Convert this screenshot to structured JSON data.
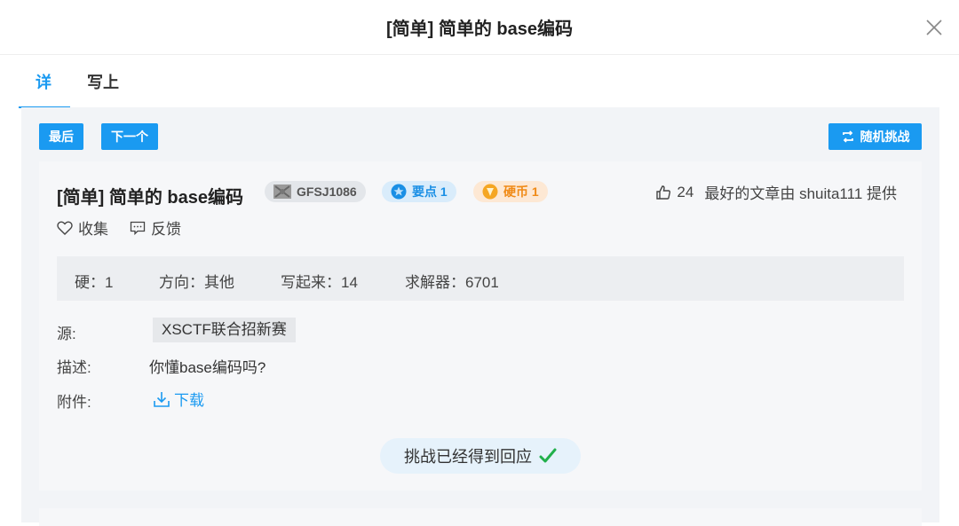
{
  "modal": {
    "title": "[简单] 简单的 base编码"
  },
  "tabs": [
    {
      "label": "详",
      "active": true
    },
    {
      "label": "写上",
      "active": false
    }
  ],
  "toolbar": {
    "last_label": "最后",
    "next_label": "下一个",
    "random_label": "随机挑战"
  },
  "challenge": {
    "title": "[简单] 简单的 base编码",
    "id_badge": "GFSJ1086",
    "points_badge": "要点 1",
    "coin_badge": "硬币 1",
    "likes": "24",
    "writeup_credit": "最好的文章由 shuita111 提供",
    "favorite_label": "收集",
    "feedback_label": "反馈",
    "stats": {
      "difficulty": "硬：1",
      "direction": "方向：其他",
      "writeups": "写起来：14",
      "solvers": "求解器：6701"
    },
    "source_label": "源:",
    "source_value": "XSCTF联合招新赛",
    "description_label": "描述:",
    "description_value": "你懂base编码吗?",
    "attachment_label": "附件:",
    "download_label": "下载",
    "status_text": "挑战已经得到回应"
  },
  "colors": {
    "accent": "#1a9af1",
    "success": "#22b04b",
    "points": "#1a8fe5",
    "coin": "#f08a16"
  },
  "icons": {
    "close": "close-icon",
    "random": "shuffle-icon",
    "like": "thumbs-up-icon",
    "favorite": "heart-icon",
    "feedback": "comment-icon",
    "download": "download-icon",
    "check": "check-icon"
  }
}
